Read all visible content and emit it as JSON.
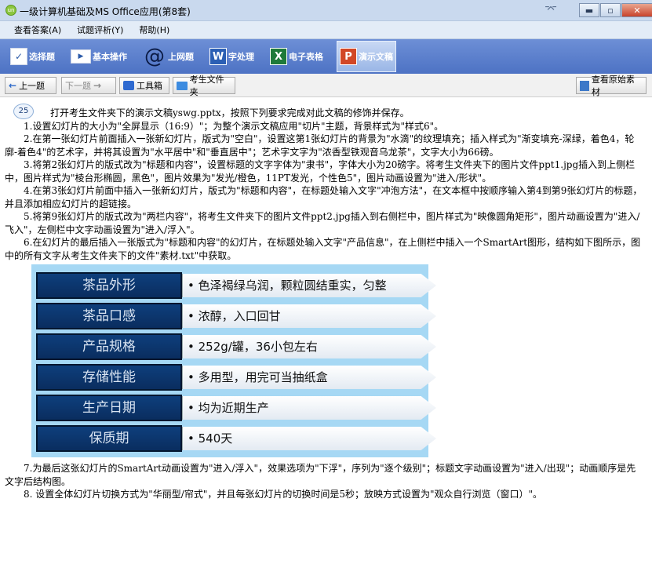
{
  "window": {
    "title": "一级计算机基础及MS Office应用(第8套)",
    "app_icon_text": "un",
    "pin_glyph": "⌤",
    "min_glyph": "▬",
    "max_glyph": "▫",
    "close_glyph": "✕"
  },
  "menu": [
    "查看答案(A)",
    "试题评析(Y)",
    "帮助(H)"
  ],
  "modes": [
    {
      "label": "选择题",
      "icon": "select-icon",
      "glyph": "✓"
    },
    {
      "label": "基本操作",
      "icon": "basic-op-icon",
      "glyph": "▶"
    },
    {
      "label": "上网题",
      "icon": "internet-icon",
      "glyph": "@"
    },
    {
      "label": "字处理",
      "icon": "word-icon",
      "glyph": "W"
    },
    {
      "label": "电子表格",
      "icon": "excel-icon",
      "glyph": "X"
    },
    {
      "label": "演示文稿",
      "icon": "ppt-icon",
      "glyph": "P"
    }
  ],
  "nav": {
    "prev": "上一题",
    "prev_arrow": "←",
    "next": "下一题",
    "next_arrow": "→",
    "toolbox": "工具箱",
    "student_folder": "考生文件夹",
    "view_material": "查看原始素材"
  },
  "question": {
    "number": "25",
    "intro": "打开考生文件夹下的演示文稿yswg.pptx，按照下列要求完成对此文稿的修饰并保存。",
    "items": [
      "1.设置幻灯片的大小为\"全屏显示（16:9）\"；为整个演示文稿应用\"切片\"主题，背景样式为\"样式6\"。",
      "2.在第一张幻灯片前面插入一张新幻灯片，版式为\"空白\"，设置这第1张幻灯片的背景为\"水滴\"的纹理填充；插入样式为\"渐变填充-深绿，着色4，轮廓-着色4\"的艺术字，并将其设置为\"水平居中\"和\"垂直居中\"；艺术字文字为\"浓香型铁观音乌龙茶\"，文字大小为66磅。",
      "3.将第2张幻灯片的版式改为\"标题和内容\"，设置标题的文字字体为\"隶书\"，字体大小为20磅字。将考生文件夹下的图片文件ppt1.jpg插入到上侧栏中，图片样式为\"棱台形椭圆，黑色\"，图片效果为\"发光/橙色，11PT发光，个性色5\"，图片动画设置为\"进入/形状\"。",
      "4.在第3张幻灯片前面中插入一张新幻灯片，版式为\"标题和内容\"，在标题处输入文字\"冲泡方法\"，在文本框中按顺序输入第4到第9张幻灯片的标题，并且添加相应幻灯片的超链接。",
      "5.将第9张幻灯片的版式改为\"两栏内容\"，将考生文件夹下的图片文件ppt2.jpg插入到右侧栏中，图片样式为\"映像圆角矩形\"，图片动画设置为\"进入/飞入\"，左侧栏中文字动画设置为\"进入/浮入\"。",
      "6.在幻灯片的最后插入一张版式为\"标题和内容\"的幻灯片，在标题处输入文字\"产品信息\"，在上侧栏中插入一个SmartArt图形，结构如下图所示，图中的所有文字从考生文件夹下的文件\"素材.txt\"中获取。"
    ],
    "smartart": [
      {
        "label": "茶品外形",
        "text": "• 色泽褐绿乌润，颗粒圆结重实，匀整"
      },
      {
        "label": "茶品口感",
        "text": "• 浓醇，入口回甘"
      },
      {
        "label": "产品规格",
        "text": "• 252g/罐，36小包左右"
      },
      {
        "label": "存储性能",
        "text": "• 多用型，用完可当抽纸盒"
      },
      {
        "label": "生产日期",
        "text": "• 均为近期生产"
      },
      {
        "label": "保质期",
        "text": "• 540天"
      }
    ],
    "items_after": [
      "7.为最后这张幻灯片的SmartArt动画设置为\"进入/浮入\"，效果选项为\"下浮\"，序列为\"逐个级别\"；标题文字动画设置为\"进入/出现\"；动画顺序是先文字后结构图。",
      "8. 设置全体幻灯片切换方式为\"华丽型/帘式\"，并且每张幻灯片的切换时间是5秒；放映方式设置为\"观众自行浏览（窗口）\"。"
    ]
  },
  "colors": {
    "mode_bar": "#5a7fcf",
    "smartart_bg": "#a6d8f4",
    "smartart_label_bg": "#0e3f7c"
  }
}
